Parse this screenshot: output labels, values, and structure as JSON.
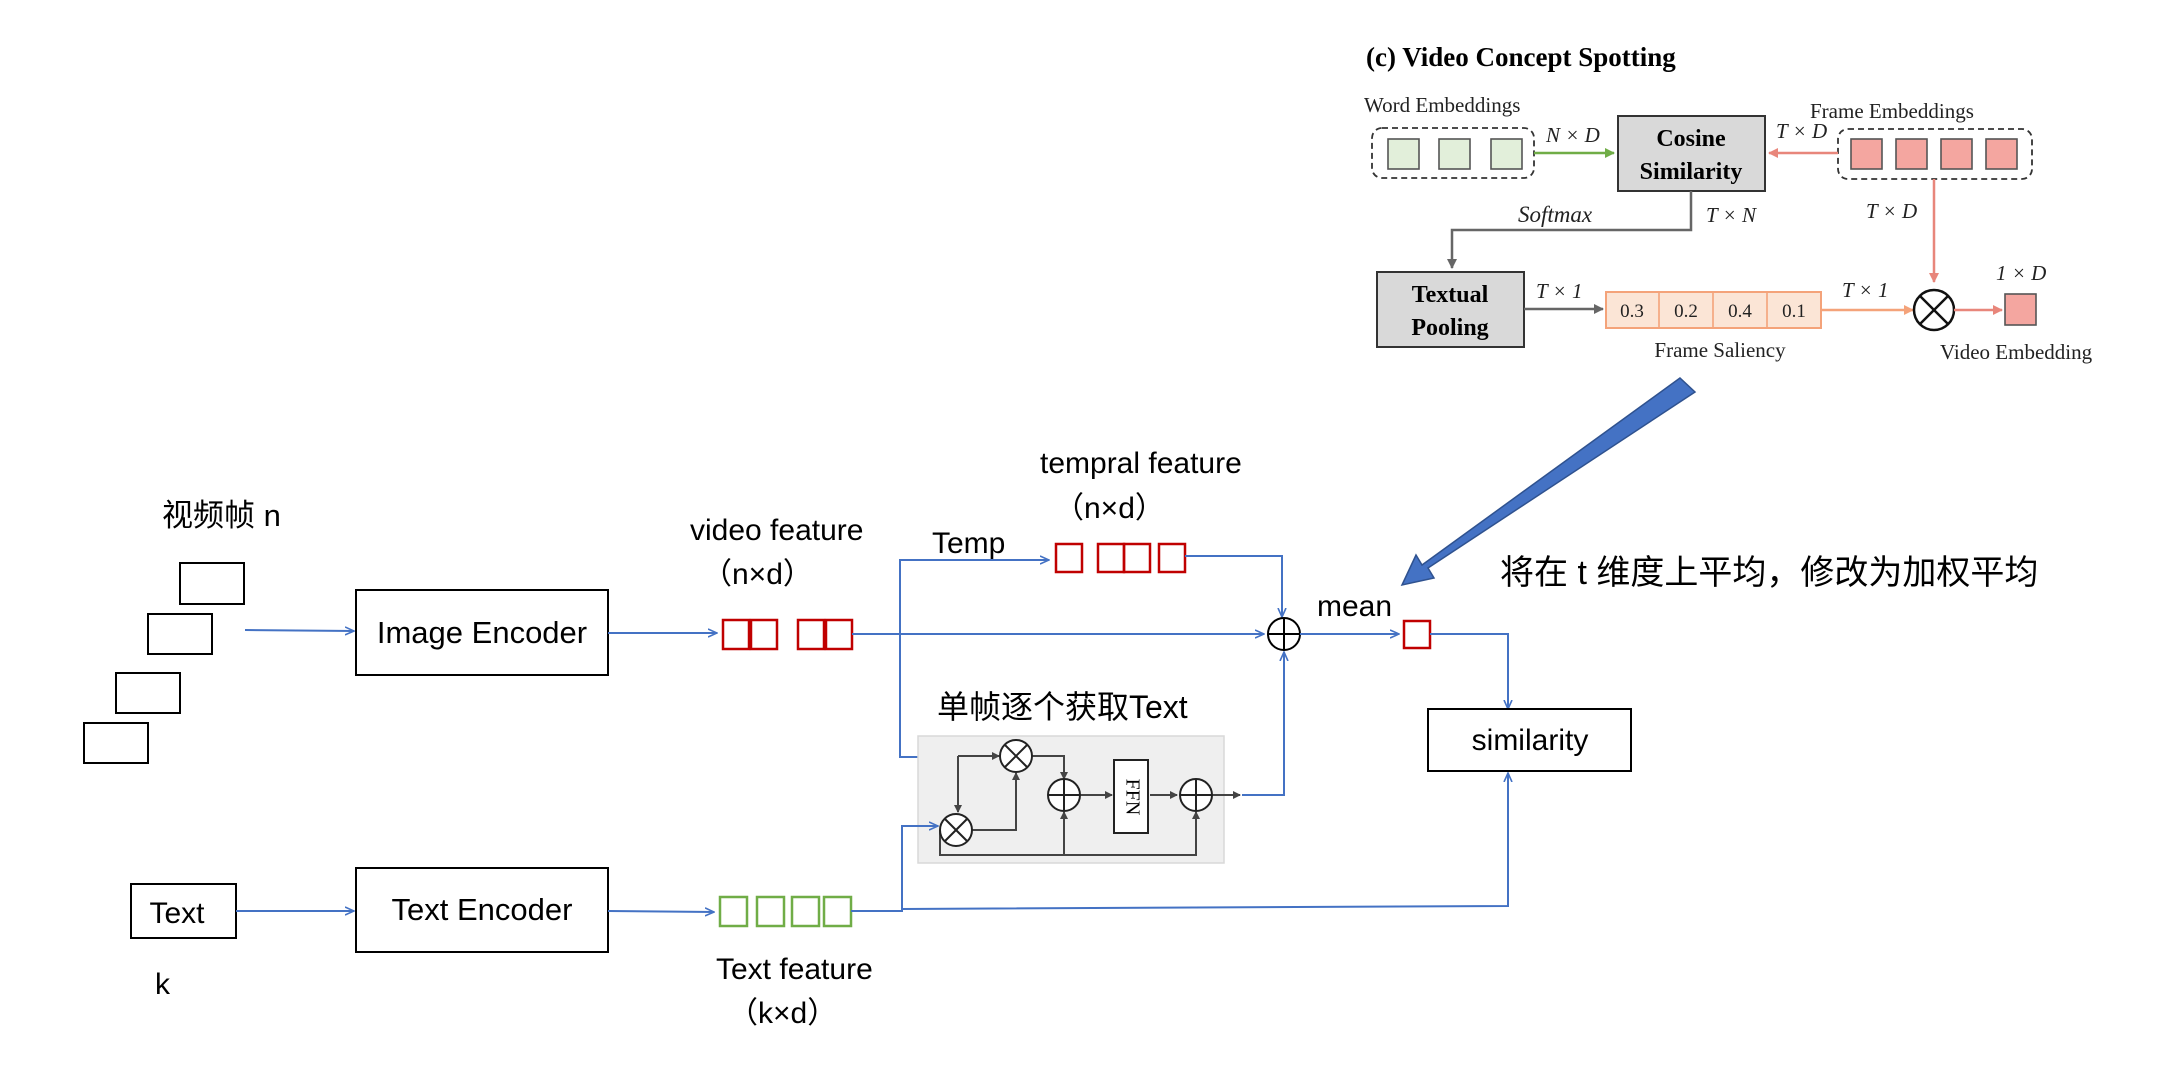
{
  "main": {
    "frames_label": "视频帧 n",
    "image_encoder": "Image Encoder",
    "text_encoder": "Text  Encoder",
    "text_input": "Text",
    "k_label": "k",
    "video_feature_label": "video feature",
    "video_feature_dim": "（n×d）",
    "temp_label": "Temp",
    "temporal_feature_label": "tempral feature",
    "temporal_feature_dim": "（n×d）",
    "text_feature_label": "Text feature",
    "text_feature_dim": "（k×d）",
    "mean_label": "mean",
    "similarity": "similarity",
    "per_frame_label": "单帧逐个获取Text",
    "ffn_label": "FFN",
    "annotation": "将在 t 维度上平均，修改为加权平均"
  },
  "inset": {
    "title": "(c) Video Concept Spotting",
    "word_embeddings": "Word Embeddings",
    "frame_embeddings": "Frame Embeddings",
    "cosine_line1": "Cosine",
    "cosine_line2": "Similarity",
    "nxd": "N × D",
    "txd_top": "T × D",
    "softmax": "Softmax",
    "txn": "T × N",
    "txd_right": "T × D",
    "pool_line1": "Textual",
    "pool_line2": "Pooling",
    "tx1_left": "T × 1",
    "tx1_right": "T × 1",
    "saliency_values": [
      "0.3",
      "0.2",
      "0.4",
      "0.1"
    ],
    "frame_saliency": "Frame Saliency",
    "one_x_d": "1 × D",
    "video_embedding": "Video Embedding"
  },
  "colors": {
    "arrow_blue": "#4472c4",
    "video_feature_red": "#c00000",
    "text_feature_green": "#70ad47",
    "big_arrow_blue": "#4472c4",
    "inset_green_fill": "#e2efda",
    "inset_red_fill": "#f4a6a0",
    "inset_orange": "#f4b183"
  }
}
